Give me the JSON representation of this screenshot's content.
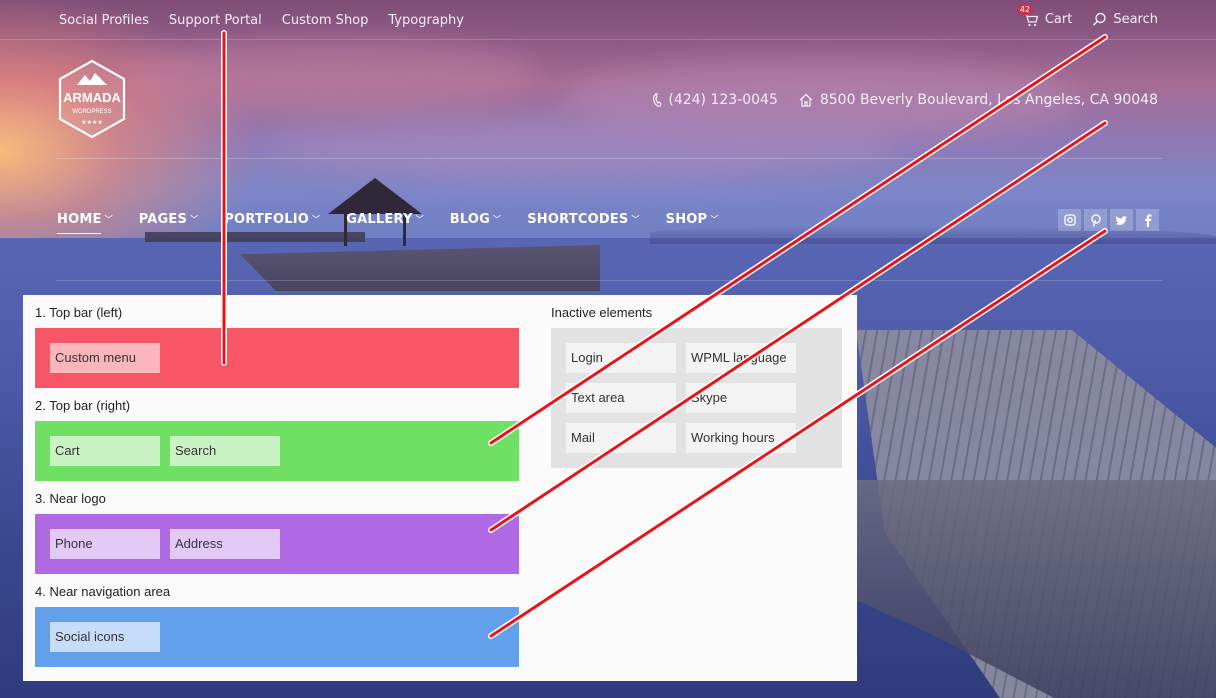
{
  "top_bar": {
    "nav_links": [
      "Social Profiles",
      "Support Portal",
      "Custom Shop",
      "Typography"
    ],
    "cart": {
      "label": "Cart",
      "badge": "42"
    },
    "search": {
      "label": "Search"
    }
  },
  "logo": {
    "name": "ARMADA",
    "sub": "WORDPRESS",
    "stars": "★★★★"
  },
  "contact": {
    "phone": "(424) 123-0045",
    "address": "8500 Beverly Boulevard, Los Angeles, CA 90048"
  },
  "main_nav": [
    {
      "label": "HOME",
      "active": true
    },
    {
      "label": "PAGES"
    },
    {
      "label": "PORTFOLIO"
    },
    {
      "label": "GALLERY"
    },
    {
      "label": "BLOG"
    },
    {
      "label": "SHORTCODES"
    },
    {
      "label": "SHOP"
    }
  ],
  "social_icons": [
    "instagram-icon",
    "pinterest-icon",
    "twitter-icon",
    "facebook-icon"
  ],
  "panel": {
    "sections": [
      {
        "title": "1. Top bar (left)",
        "chips": [
          "Custom menu"
        ],
        "color": "#f75667"
      },
      {
        "title": "2. Top bar (right)",
        "chips": [
          "Cart",
          "Search"
        ],
        "color": "#6fe063"
      },
      {
        "title": "3. Near logo",
        "chips": [
          "Phone",
          "Address"
        ],
        "color": "#b06ae3"
      },
      {
        "title": "4. Near navigation area",
        "chips": [
          "Social icons"
        ],
        "color": "#62a0ec"
      }
    ],
    "inactive": {
      "title": "Inactive elements",
      "chips": [
        "Login",
        "WPML language",
        "Text area",
        "Skype",
        "Mail",
        "Working hours"
      ]
    }
  },
  "colors": {
    "connector": "#e8141b"
  }
}
